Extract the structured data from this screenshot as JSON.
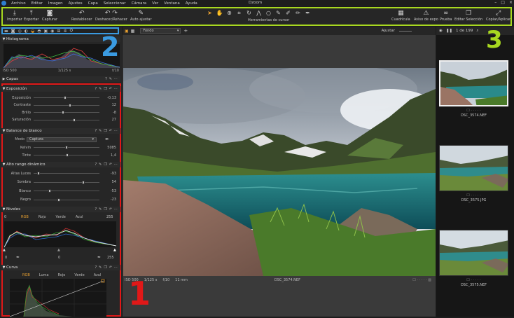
{
  "app": {
    "title": "Dzoom"
  },
  "menu": [
    "Archivo",
    "Editar",
    "Imagen",
    "Ajustes",
    "Capa",
    "Seleccionar",
    "Cámara",
    "Ver",
    "Ventana",
    "Ayuda"
  ],
  "toolbar": {
    "importar": "Importar",
    "exportar": "Exportar",
    "capturar": "Capturar",
    "restablecer": "Restablecer",
    "deshacer": "Deshacer/Rehacer",
    "auto": "Auto ajustar",
    "cursor_tools": "Herramientas de cursor",
    "cuadricula": "Cuadrícula",
    "aviso": "Aviso de expo",
    "prueba": "Prueba",
    "editar_sel": "Editar Selección",
    "copiar": "Copiar/Aplicar"
  },
  "left": {
    "histograma": "Histograma",
    "histo_info": {
      "iso": "ISO 500",
      "shutter": "1/125 s",
      "fstop": "f/10"
    },
    "capas": "Capas",
    "exposicion": {
      "title": "Exposición",
      "rows": [
        {
          "label": "Exposición",
          "value": "-0,13",
          "pos": 0.48
        },
        {
          "label": "Contraste",
          "value": "12",
          "pos": 0.55
        },
        {
          "label": "Brillo",
          "value": "-8",
          "pos": 0.44
        },
        {
          "label": "Saturación",
          "value": "27",
          "pos": 0.62
        }
      ]
    },
    "balance": {
      "title": "Balance de blanco",
      "modo_label": "Modo",
      "modo_value": "Captura",
      "rows": [
        {
          "label": "Kelvin",
          "value": "5085",
          "pos": 0.5
        },
        {
          "label": "Tinte",
          "value": "1,4",
          "pos": 0.51
        }
      ]
    },
    "hdr": {
      "title": "Alto rango dinámico",
      "rows": [
        {
          "label": "Altas Luces",
          "value": "-93",
          "pos": 0.05
        },
        {
          "label": "Sombra",
          "value": "54",
          "pos": 0.77
        },
        {
          "label": "Blanco",
          "value": "-53",
          "pos": 0.23
        },
        {
          "label": "Negro",
          "value": "-23",
          "pos": 0.38
        }
      ]
    },
    "niveles": {
      "title": "Niveles",
      "tabs": [
        "RGB",
        "Rojo",
        "Verde",
        "Azul"
      ],
      "left_val": "0",
      "right_val": "255",
      "bottom_left": "0",
      "bottom_mid": "0",
      "bottom_right": "255"
    },
    "curva": {
      "title": "Curva",
      "tabs": [
        "RGB",
        "Luma",
        "Rojo",
        "Verde",
        "Azul"
      ]
    }
  },
  "viewer": {
    "fondo": "Fondo",
    "ajustar": "Ajustar",
    "info": {
      "iso": "ISO 500",
      "shutter": "1/125 s",
      "fstop": "f/10",
      "focal": "11 mm",
      "filename": "DSC_3574.NEF"
    }
  },
  "browser": {
    "counter": "1 de 199",
    "thumbs": [
      {
        "name": "DSC_3574.NEF"
      },
      {
        "name": "DSC_3575.JPG"
      },
      {
        "name": "DSC_3575.NEF"
      }
    ]
  },
  "annotations": {
    "one": "1",
    "two": "2",
    "three": "3"
  },
  "colors": {
    "annotation_red": "#e01818",
    "annotation_blue": "#3a9ae0",
    "annotation_green": "#a8d820",
    "accent": "#e8a030"
  }
}
